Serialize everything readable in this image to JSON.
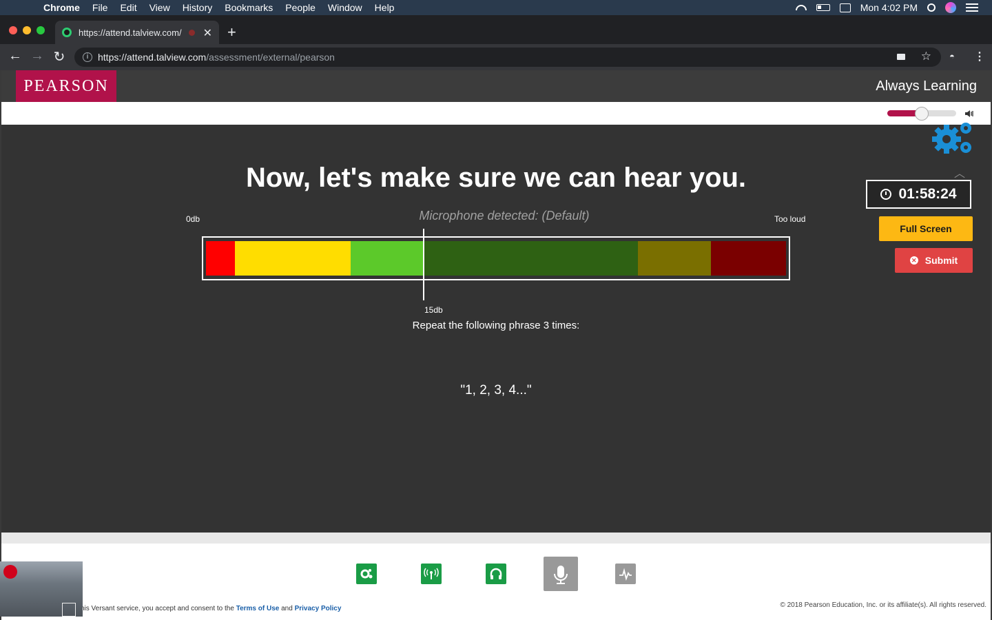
{
  "menubar": {
    "app": "Chrome",
    "items": [
      "File",
      "Edit",
      "View",
      "History",
      "Bookmarks",
      "People",
      "Window",
      "Help"
    ],
    "clock": "Mon 4:02 PM"
  },
  "browser": {
    "tab_title": "https://attend.talview.com/",
    "url_host": "https://attend.talview.com",
    "url_path": "/assessment/external/pearson"
  },
  "header": {
    "logo": "PEARSON",
    "tagline": "Always Learning"
  },
  "volume": {
    "level": 0.5
  },
  "test": {
    "headline": "Now, let's make sure we can hear you.",
    "mic_status": "Microphone detected: (Default)",
    "scale_min": "0db",
    "scale_max": "Too loud",
    "marker_label": "15db",
    "instruction": "Repeat the following phrase 3 times:",
    "phrase": "\"1, 2, 3, 4...\""
  },
  "meter": {
    "segments": [
      {
        "color": "#ff0000",
        "fraction": 0.05
      },
      {
        "color": "#ffdd00",
        "fraction": 0.2
      },
      {
        "color": "#5cc92a",
        "fraction": 0.125
      },
      {
        "color": "#2e6113",
        "fraction": 0.37
      },
      {
        "color": "#7a6f00",
        "fraction": 0.125
      },
      {
        "color": "#7a0000",
        "fraction": 0.13
      }
    ],
    "marker_fraction": 0.375
  },
  "sidebar": {
    "timer": "01:58:24",
    "fullscreen_label": "Full Screen",
    "submit_label": "Submit"
  },
  "footer": {
    "consent_prefix": "his Versant service, you accept and consent to the ",
    "terms_label": "Terms of Use",
    "and_label": " and ",
    "privacy_label": "Privacy Policy",
    "copyright": "© 2018 Pearson Education, Inc. or its affiliate(s). All rights reserved."
  },
  "colors": {
    "brand": "#b1124a",
    "accent_yellow": "#fdb813",
    "danger": "#e04343",
    "tool_green": "#1a9c46"
  }
}
